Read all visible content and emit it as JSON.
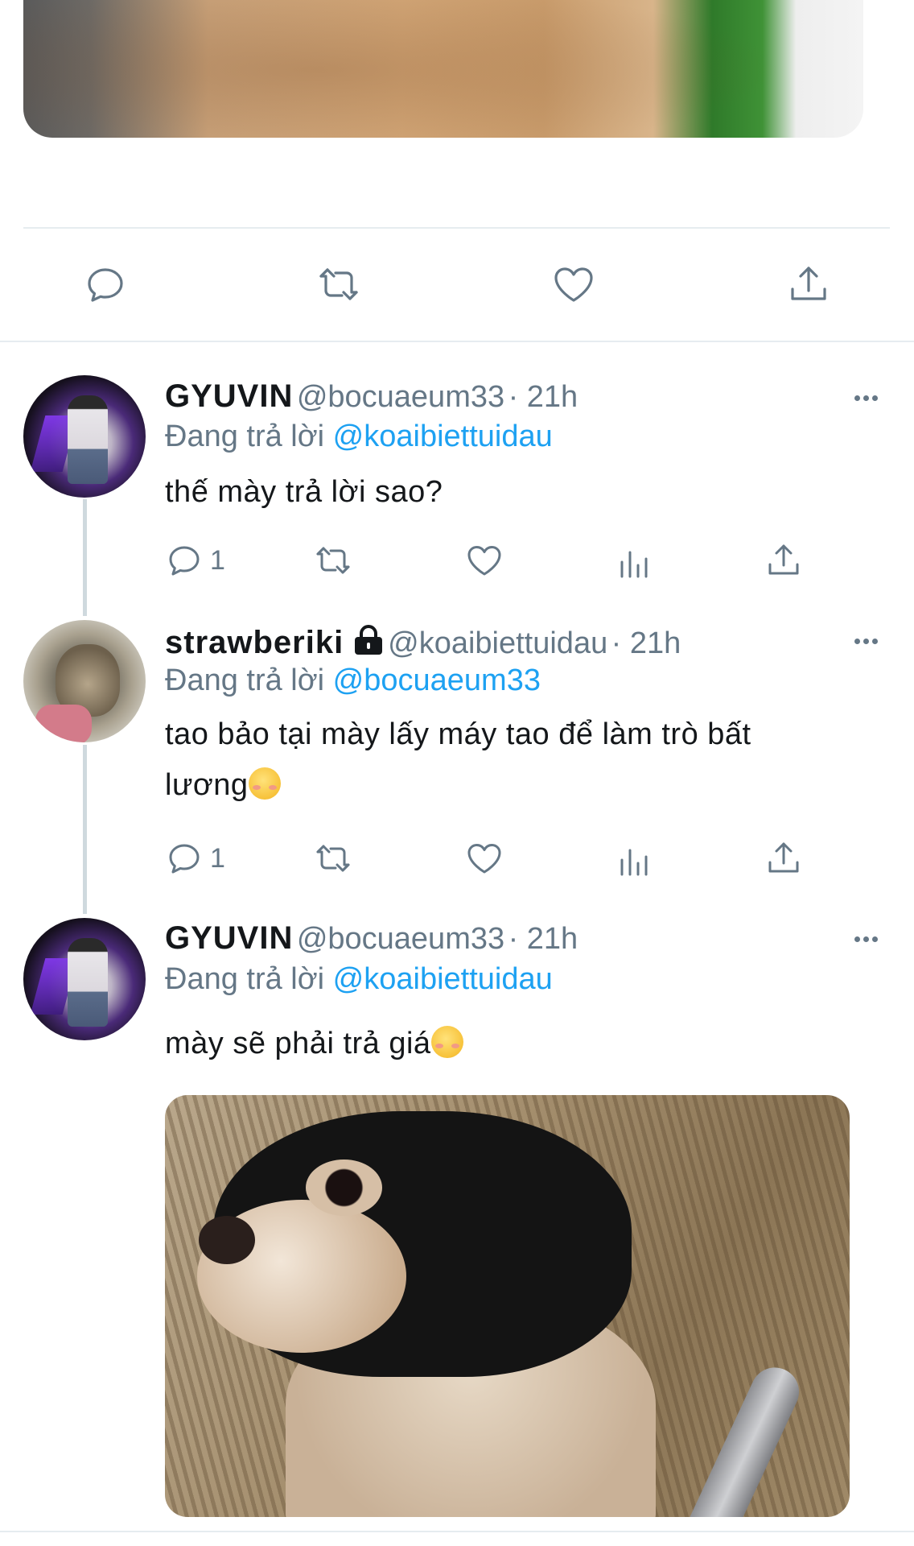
{
  "main_tweet": {
    "actions": {
      "reply": "reply-icon",
      "retweet": "retweet-icon",
      "like": "like-icon",
      "share": "share-icon"
    }
  },
  "replies": [
    {
      "name": "GYUVIN",
      "handle": "@bocuaeum33",
      "time": "· 21h",
      "reply_prefix": "Đang trả lời ",
      "reply_to": "@koaibiettuidau",
      "text": "thế mày trả lời sao?",
      "reply_count": "1",
      "avatar": "gyuvin-avatar"
    },
    {
      "name": "strawberiki",
      "handle": "@koaibiettuidau",
      "time": "· 21h",
      "reply_prefix": "Đang trả lời ",
      "reply_to": "@bocuaeum33",
      "text_line1": "tao bảo tại mày lấy máy tao để làm trò bất",
      "text_line2": "lương",
      "protected": true,
      "reply_count": "1",
      "avatar": "cat-avatar"
    },
    {
      "name": "GYUVIN",
      "handle": "@bocuaeum33",
      "time": "· 21h",
      "reply_prefix": "Đang trả lời ",
      "reply_to": "@koaibiettuidau",
      "text": "mày sẽ phải trả giá",
      "avatar": "gyuvin-avatar"
    }
  ],
  "colors": {
    "accent": "#1da1f2",
    "muted": "#657786",
    "divider": "#e6ecf0"
  }
}
